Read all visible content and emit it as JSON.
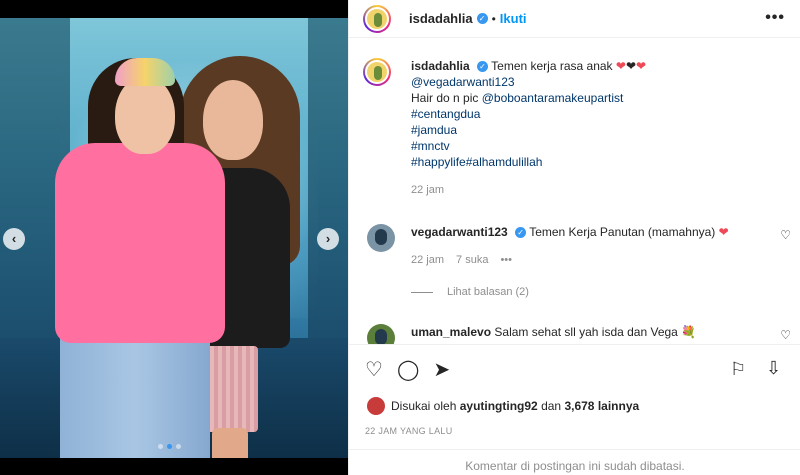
{
  "post": {
    "username": "isdadahlia",
    "follow_label": "Ikuti",
    "more_label": "•••",
    "caption": {
      "text": "Temen kerja rasa anak",
      "mention": "@vegadarwanti123",
      "hair_prefix": "Hair do n pic",
      "hair_mention": "@boboantaramakeupartist",
      "tags": [
        "#centangdua",
        "#jamdua",
        "#mnctv"
      ],
      "tag_happy": "#happylife",
      "tag_alhamdulillah": "#alhamdulillah",
      "time": "22 jam"
    },
    "comments": [
      {
        "username": "vegadarwanti123",
        "text": "Temen Kerja Panutan (mamahnya)",
        "time": "22 jam",
        "likes": "7 suka",
        "more": "•••",
        "replies": "Lihat balasan (2)"
      },
      {
        "username": "uman_malevo",
        "text": "Salam sehat sll yah isda dan Vega"
      }
    ],
    "likes": {
      "prefix": "Disukai oleh",
      "user": "ayutingting92",
      "middle": "dan",
      "others": "3,678 lainnya"
    },
    "posted": "22 JAM YANG LALU",
    "comments_disabled": "Komentar di postingan ini sudah dibatasi."
  },
  "carousel": {
    "current": 2,
    "total": 3
  },
  "colors": {
    "accent": "#0095f6",
    "heart": "#ed4956"
  }
}
